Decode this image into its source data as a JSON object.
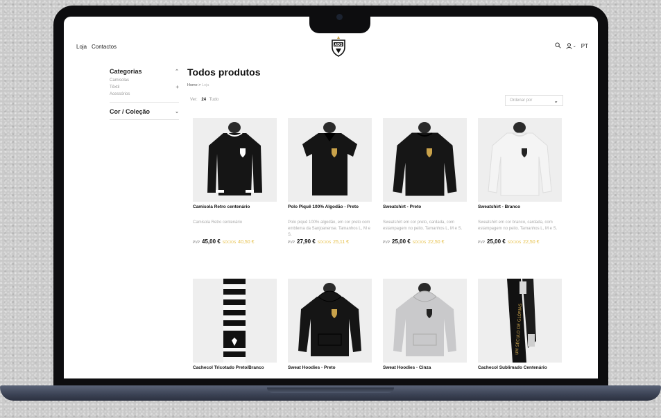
{
  "header": {
    "nav": [
      "Loja",
      "Contactos"
    ],
    "logo_text": "ADS",
    "search_icon": "search-icon",
    "user_icon": "user-icon",
    "language": "PT"
  },
  "sidebar": {
    "categories_title": "Categorias",
    "categories": [
      "Camisolas",
      "Têxtil",
      "Acessórios"
    ],
    "color_title": "Cor / Coleção"
  },
  "main": {
    "title": "Todos produtos",
    "breadcrumb": [
      "Home",
      "Loja"
    ],
    "per_page_label": "Ver:",
    "per_page_options": [
      "24",
      "Tudo"
    ],
    "sort_placeholder": "Ordenar por",
    "pvp_label": "PVP",
    "socio_label": "SÓCIOS"
  },
  "products": [
    {
      "name": "Camisola Retro centenário",
      "desc": "Camisola Retro centenário",
      "price": "45,00 €",
      "socio": "40,50 €",
      "colors": {
        "body": "#151515",
        "accent": "#ffffff"
      }
    },
    {
      "name": "Polo Piquê 100% Algodão - Preto",
      "desc": "Polo piquê 100% algodão, em cor preto com emblema da Sanjoanense. Tamanhos L, M e S.",
      "price": "27,90 €",
      "socio": "25,11 €",
      "colors": {
        "body": "#151515",
        "accent": "#c9a24a"
      }
    },
    {
      "name": "Sweatshirt - Preto",
      "desc": "Sweatshirt em cor preto, cardada, com estampagem no peito. Tamanhos L, M e S.",
      "price": "25,00 €",
      "socio": "22,50 €",
      "colors": {
        "body": "#161616",
        "accent": "#c9a24a"
      }
    },
    {
      "name": "Sweatshirt - Branco",
      "desc": "Sweatshirt em cor branco, cardada, com estampagem no peito. Tamanhos L, M e S.",
      "price": "25,00 €",
      "socio": "22,50 €",
      "colors": {
        "body": "#f4f4f4",
        "accent": "#222222"
      }
    },
    {
      "name": "Cachecol Tricotado Preto/Branco",
      "colors": {
        "body": "#111111",
        "accent": "#ffffff"
      }
    },
    {
      "name": "Sweat Hoodies - Preto",
      "colors": {
        "body": "#151515",
        "accent": "#c9a24a"
      }
    },
    {
      "name": "Sweat Hoodies - Cinza",
      "colors": {
        "body": "#c9c9cb",
        "accent": "#222222"
      }
    },
    {
      "name": "Cachecol Sublimado Centenário",
      "scarf_text": "UM SÉCULO DE GLÓRIAS",
      "colors": {
        "body": "#111111",
        "accent": "#c9a24a"
      }
    }
  ]
}
